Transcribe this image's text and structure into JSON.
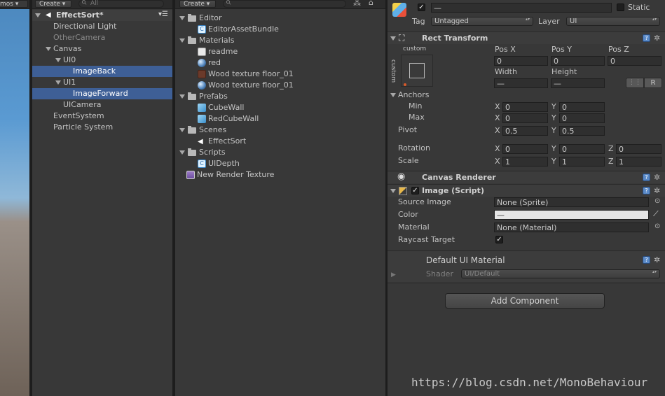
{
  "scene_panel": {
    "tab_label": "mos"
  },
  "hierarchy": {
    "create_label": "Create",
    "search_placeholder": "All",
    "scene_name": "EffectSort*",
    "items": [
      {
        "label": "Directional Light"
      },
      {
        "label": "OtherCamera"
      },
      {
        "label": "Canvas"
      },
      {
        "label": "UI0"
      },
      {
        "label": "ImageBack"
      },
      {
        "label": "UI1"
      },
      {
        "label": "ImageForward"
      },
      {
        "label": "UICamera"
      },
      {
        "label": "EventSystem"
      },
      {
        "label": "Particle System"
      }
    ]
  },
  "project": {
    "create_label": "Create",
    "items": [
      {
        "label": "Editor",
        "icon": "folder-icon"
      },
      {
        "label": "EditorAssetBundle",
        "icon": "script-icon"
      },
      {
        "label": "Materials",
        "icon": "folder-icon"
      },
      {
        "label": "readme",
        "icon": "text-file-icon"
      },
      {
        "label": "red",
        "icon": "material-sphere-icon"
      },
      {
        "label": "Wood texture floor_01",
        "icon": "texture-icon"
      },
      {
        "label": "Wood texture floor_01",
        "icon": "material-sphere-icon"
      },
      {
        "label": "Prefabs",
        "icon": "folder-icon"
      },
      {
        "label": "CubeWall",
        "icon": "prefab-cube-icon"
      },
      {
        "label": "RedCubeWall",
        "icon": "prefab-cube-icon"
      },
      {
        "label": "Scenes",
        "icon": "folder-icon"
      },
      {
        "label": "EffectSort",
        "icon": "unity-scene-icon"
      },
      {
        "label": "Scripts",
        "icon": "folder-icon"
      },
      {
        "label": "UIDepth",
        "icon": "script-icon"
      },
      {
        "label": "New Render Texture",
        "icon": "render-texture-icon"
      }
    ]
  },
  "inspector": {
    "object_name": "—",
    "static_label": "Static",
    "tag_label": "Tag",
    "tag_value": "Untagged",
    "layer_label": "Layer",
    "layer_value": "UI",
    "rect_transform": {
      "title": "Rect Transform",
      "anchor_preset_top": "custom",
      "anchor_preset_side": "custom",
      "pos_x_label": "Pos X",
      "pos_y_label": "Pos Y",
      "pos_z_label": "Pos Z",
      "pos_x": "0",
      "pos_y": "0",
      "pos_z": "0",
      "width_label": "Width",
      "height_label": "Height",
      "width": "—",
      "height": "—",
      "r_label": "R",
      "anchors_label": "Anchors",
      "min_label": "Min",
      "max_label": "Max",
      "min_x": "0",
      "min_y": "0",
      "max_x": "0",
      "max_y": "0",
      "pivot_label": "Pivot",
      "pivot_x": "0.5",
      "pivot_y": "0.5",
      "rotation_label": "Rotation",
      "rot_x": "0",
      "rot_y": "0",
      "rot_z": "0",
      "scale_label": "Scale",
      "scale_x": "1",
      "scale_y": "1",
      "scale_z": "1",
      "x": "X",
      "y": "Y",
      "z": "Z"
    },
    "canvas_renderer": {
      "title": "Canvas Renderer"
    },
    "image": {
      "title": "Image (Script)",
      "source_image_label": "Source Image",
      "source_image_value": "None (Sprite)",
      "color_label": "Color",
      "color_value": "—",
      "material_label": "Material",
      "material_value": "None (Material)",
      "raycast_label": "Raycast Target"
    },
    "material": {
      "title": "Default UI Material",
      "shader_label": "Shader",
      "shader_value": "UI/Default"
    },
    "add_component_label": "Add Component"
  },
  "watermark": "https://blog.csdn.net/MonoBehaviour",
  "colors": {
    "selection": "#3e5f96",
    "panel": "#383838",
    "accent": "#5a8ac8"
  }
}
